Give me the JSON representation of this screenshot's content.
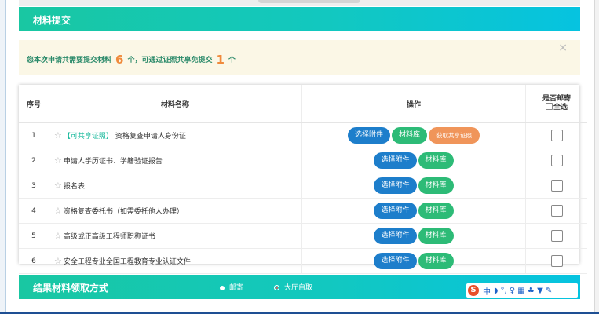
{
  "section1": {
    "title": "材料提交"
  },
  "notice": {
    "text1": "您本次申请共需要提交材料",
    "total": "6",
    "text2": "个，可通过证照共享免提交",
    "shared": "1",
    "text3": "个",
    "close": "×"
  },
  "table": {
    "headers": {
      "index": "序号",
      "name": "材料名称",
      "operation": "操作",
      "mail_line1": "是否邮寄",
      "mail_select_all": "全选"
    },
    "buttons": {
      "attach": "选择附件",
      "library": "材料库",
      "shared_cert": "获取共享证照"
    },
    "rows": [
      {
        "index": "1",
        "tag": "【可共享证照】",
        "name": "资格复查申请人身份证"
      },
      {
        "index": "2",
        "tag": "",
        "name": "申请人学历证书、学籍验证报告"
      },
      {
        "index": "3",
        "tag": "",
        "name": "报名表"
      },
      {
        "index": "4",
        "tag": "",
        "name": "资格复查委托书（如需委托他人办理）"
      },
      {
        "index": "5",
        "tag": "",
        "name": "高级或正高级工程师职称证书"
      },
      {
        "index": "6",
        "tag": "",
        "name": "安全工程专业全国工程教育专业认证文件"
      }
    ]
  },
  "section2": {
    "title": "结果材料领取方式",
    "option_mail": "邮寄",
    "option_pickup": "大厅自取"
  },
  "ime": {
    "logo": "S",
    "mode": "中",
    "glyphs": "◗ °, ♀ ▦ ♣ ▼ ✎"
  },
  "colors": {
    "accent_teal": "#19c7a2",
    "button_blue": "#1d7ecb",
    "button_green": "#2dbb77",
    "button_orange": "#f0955a",
    "count_orange": "#f08a3c"
  }
}
